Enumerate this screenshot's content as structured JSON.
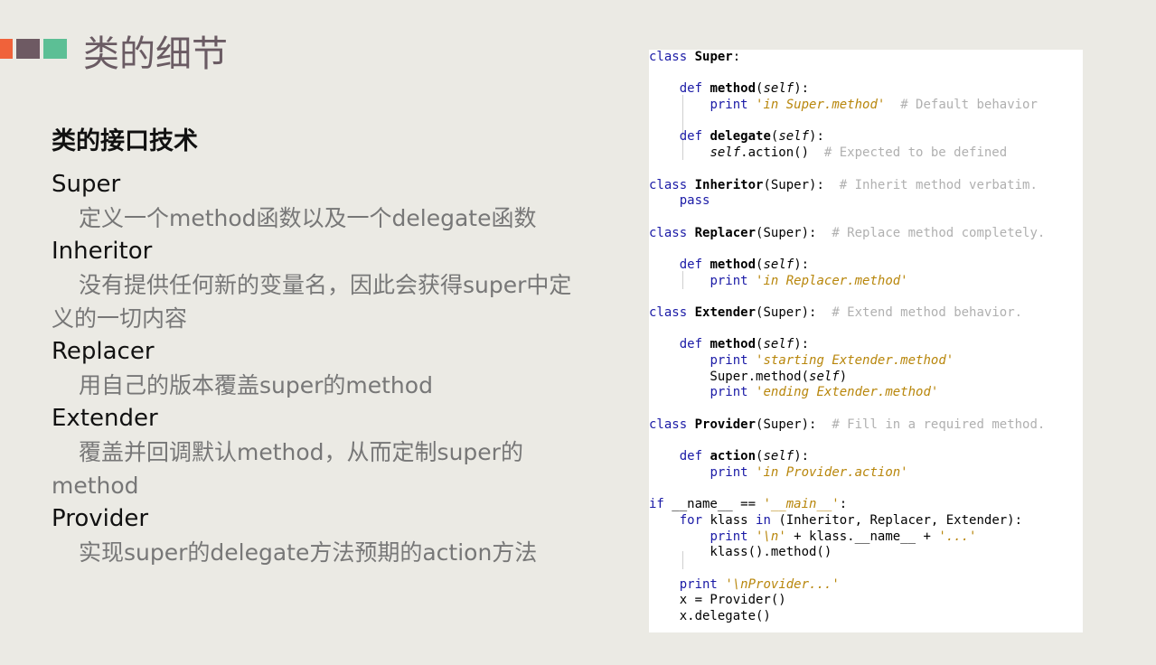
{
  "header": {
    "title": "类的细节",
    "accent_colors": [
      "#f0623a",
      "#6e5a63",
      "#5cbf95"
    ]
  },
  "left": {
    "section_title": "类的接口技术",
    "items": [
      {
        "name": "Super",
        "desc": "定义一个method函数以及一个delegate函数"
      },
      {
        "name": "Inheritor",
        "desc": "没有提供任何新的变量名，因此会获得super中定义的一切内容"
      },
      {
        "name": "Replacer",
        "desc": "用自己的版本覆盖super的method"
      },
      {
        "name": "Extender",
        "desc": "覆盖并回调默认method，从而定制super的method"
      },
      {
        "name": "Provider",
        "desc": "实现super的delegate方法预期的action方法"
      }
    ]
  },
  "code": {
    "lines": [
      [
        [
          "kw",
          "class"
        ],
        [
          "t",
          " "
        ],
        [
          "nm",
          "Super"
        ],
        [
          "t",
          ":"
        ]
      ],
      [],
      [
        [
          "t",
          "    "
        ],
        [
          "kw",
          "def"
        ],
        [
          "t",
          " "
        ],
        [
          "nm",
          "method"
        ],
        [
          "t",
          "("
        ],
        [
          "self",
          "self"
        ],
        [
          "t",
          "):"
        ]
      ],
      [
        [
          "t",
          "        "
        ],
        [
          "kw",
          "print"
        ],
        [
          "t",
          " "
        ],
        [
          "str",
          "'in Super.method'"
        ],
        [
          "t",
          "  "
        ],
        [
          "cm",
          "# Default behavior"
        ]
      ],
      [],
      [
        [
          "t",
          "    "
        ],
        [
          "kw",
          "def"
        ],
        [
          "t",
          " "
        ],
        [
          "nm",
          "delegate"
        ],
        [
          "t",
          "("
        ],
        [
          "self",
          "self"
        ],
        [
          "t",
          "):"
        ]
      ],
      [
        [
          "t",
          "        "
        ],
        [
          "self",
          "self"
        ],
        [
          "t",
          ".action()  "
        ],
        [
          "cm",
          "# Expected to be defined"
        ]
      ],
      [],
      [
        [
          "kw",
          "class"
        ],
        [
          "t",
          " "
        ],
        [
          "nm",
          "Inheritor"
        ],
        [
          "t",
          "(Super):  "
        ],
        [
          "cm",
          "# Inherit method verbatim."
        ]
      ],
      [
        [
          "t",
          "    "
        ],
        [
          "kw",
          "pass"
        ]
      ],
      [],
      [
        [
          "kw",
          "class"
        ],
        [
          "t",
          " "
        ],
        [
          "nm",
          "Replacer"
        ],
        [
          "t",
          "(Super):  "
        ],
        [
          "cm",
          "# Replace method completely."
        ]
      ],
      [],
      [
        [
          "t",
          "    "
        ],
        [
          "kw",
          "def"
        ],
        [
          "t",
          " "
        ],
        [
          "nm",
          "method"
        ],
        [
          "t",
          "("
        ],
        [
          "self",
          "self"
        ],
        [
          "t",
          "):"
        ]
      ],
      [
        [
          "t",
          "        "
        ],
        [
          "kw",
          "print"
        ],
        [
          "t",
          " "
        ],
        [
          "str",
          "'in Replacer.method'"
        ]
      ],
      [],
      [
        [
          "kw",
          "class"
        ],
        [
          "t",
          " "
        ],
        [
          "nm",
          "Extender"
        ],
        [
          "t",
          "(Super):  "
        ],
        [
          "cm",
          "# Extend method behavior."
        ]
      ],
      [],
      [
        [
          "t",
          "    "
        ],
        [
          "kw",
          "def"
        ],
        [
          "t",
          " "
        ],
        [
          "nm",
          "method"
        ],
        [
          "t",
          "("
        ],
        [
          "self",
          "self"
        ],
        [
          "t",
          "):"
        ]
      ],
      [
        [
          "t",
          "        "
        ],
        [
          "kw",
          "print"
        ],
        [
          "t",
          " "
        ],
        [
          "str",
          "'starting Extender.method'"
        ]
      ],
      [
        [
          "t",
          "        Super.method("
        ],
        [
          "self",
          "self"
        ],
        [
          "t",
          ")"
        ]
      ],
      [
        [
          "t",
          "        "
        ],
        [
          "kw",
          "print"
        ],
        [
          "t",
          " "
        ],
        [
          "str",
          "'ending Extender.method'"
        ]
      ],
      [],
      [
        [
          "kw",
          "class"
        ],
        [
          "t",
          " "
        ],
        [
          "nm",
          "Provider"
        ],
        [
          "t",
          "(Super):  "
        ],
        [
          "cm",
          "# Fill in a required method."
        ]
      ],
      [],
      [
        [
          "t",
          "    "
        ],
        [
          "kw",
          "def"
        ],
        [
          "t",
          " "
        ],
        [
          "nm",
          "action"
        ],
        [
          "t",
          "("
        ],
        [
          "self",
          "self"
        ],
        [
          "t",
          "):"
        ]
      ],
      [
        [
          "t",
          "        "
        ],
        [
          "kw",
          "print"
        ],
        [
          "t",
          " "
        ],
        [
          "str",
          "'in Provider.action'"
        ]
      ],
      [],
      [
        [
          "kw",
          "if"
        ],
        [
          "t",
          " __name__ == "
        ],
        [
          "str",
          "'__main__'"
        ],
        [
          "t",
          ":"
        ]
      ],
      [
        [
          "t",
          "    "
        ],
        [
          "kw",
          "for"
        ],
        [
          "t",
          " klass "
        ],
        [
          "kw",
          "in"
        ],
        [
          "t",
          " (Inheritor, Replacer, Extender):"
        ]
      ],
      [
        [
          "t",
          "        "
        ],
        [
          "kw",
          "print"
        ],
        [
          "t",
          " "
        ],
        [
          "str",
          "'\\n'"
        ],
        [
          "t",
          " + klass.__name__ + "
        ],
        [
          "str",
          "'...'"
        ]
      ],
      [
        [
          "t",
          "        klass().method()"
        ]
      ],
      [],
      [
        [
          "t",
          "    "
        ],
        [
          "kw",
          "print"
        ],
        [
          "t",
          " "
        ],
        [
          "str",
          "'\\nProvider...'"
        ]
      ],
      [
        [
          "t",
          "    x = Provider()"
        ]
      ],
      [
        [
          "t",
          "    x.delegate()"
        ]
      ]
    ]
  }
}
